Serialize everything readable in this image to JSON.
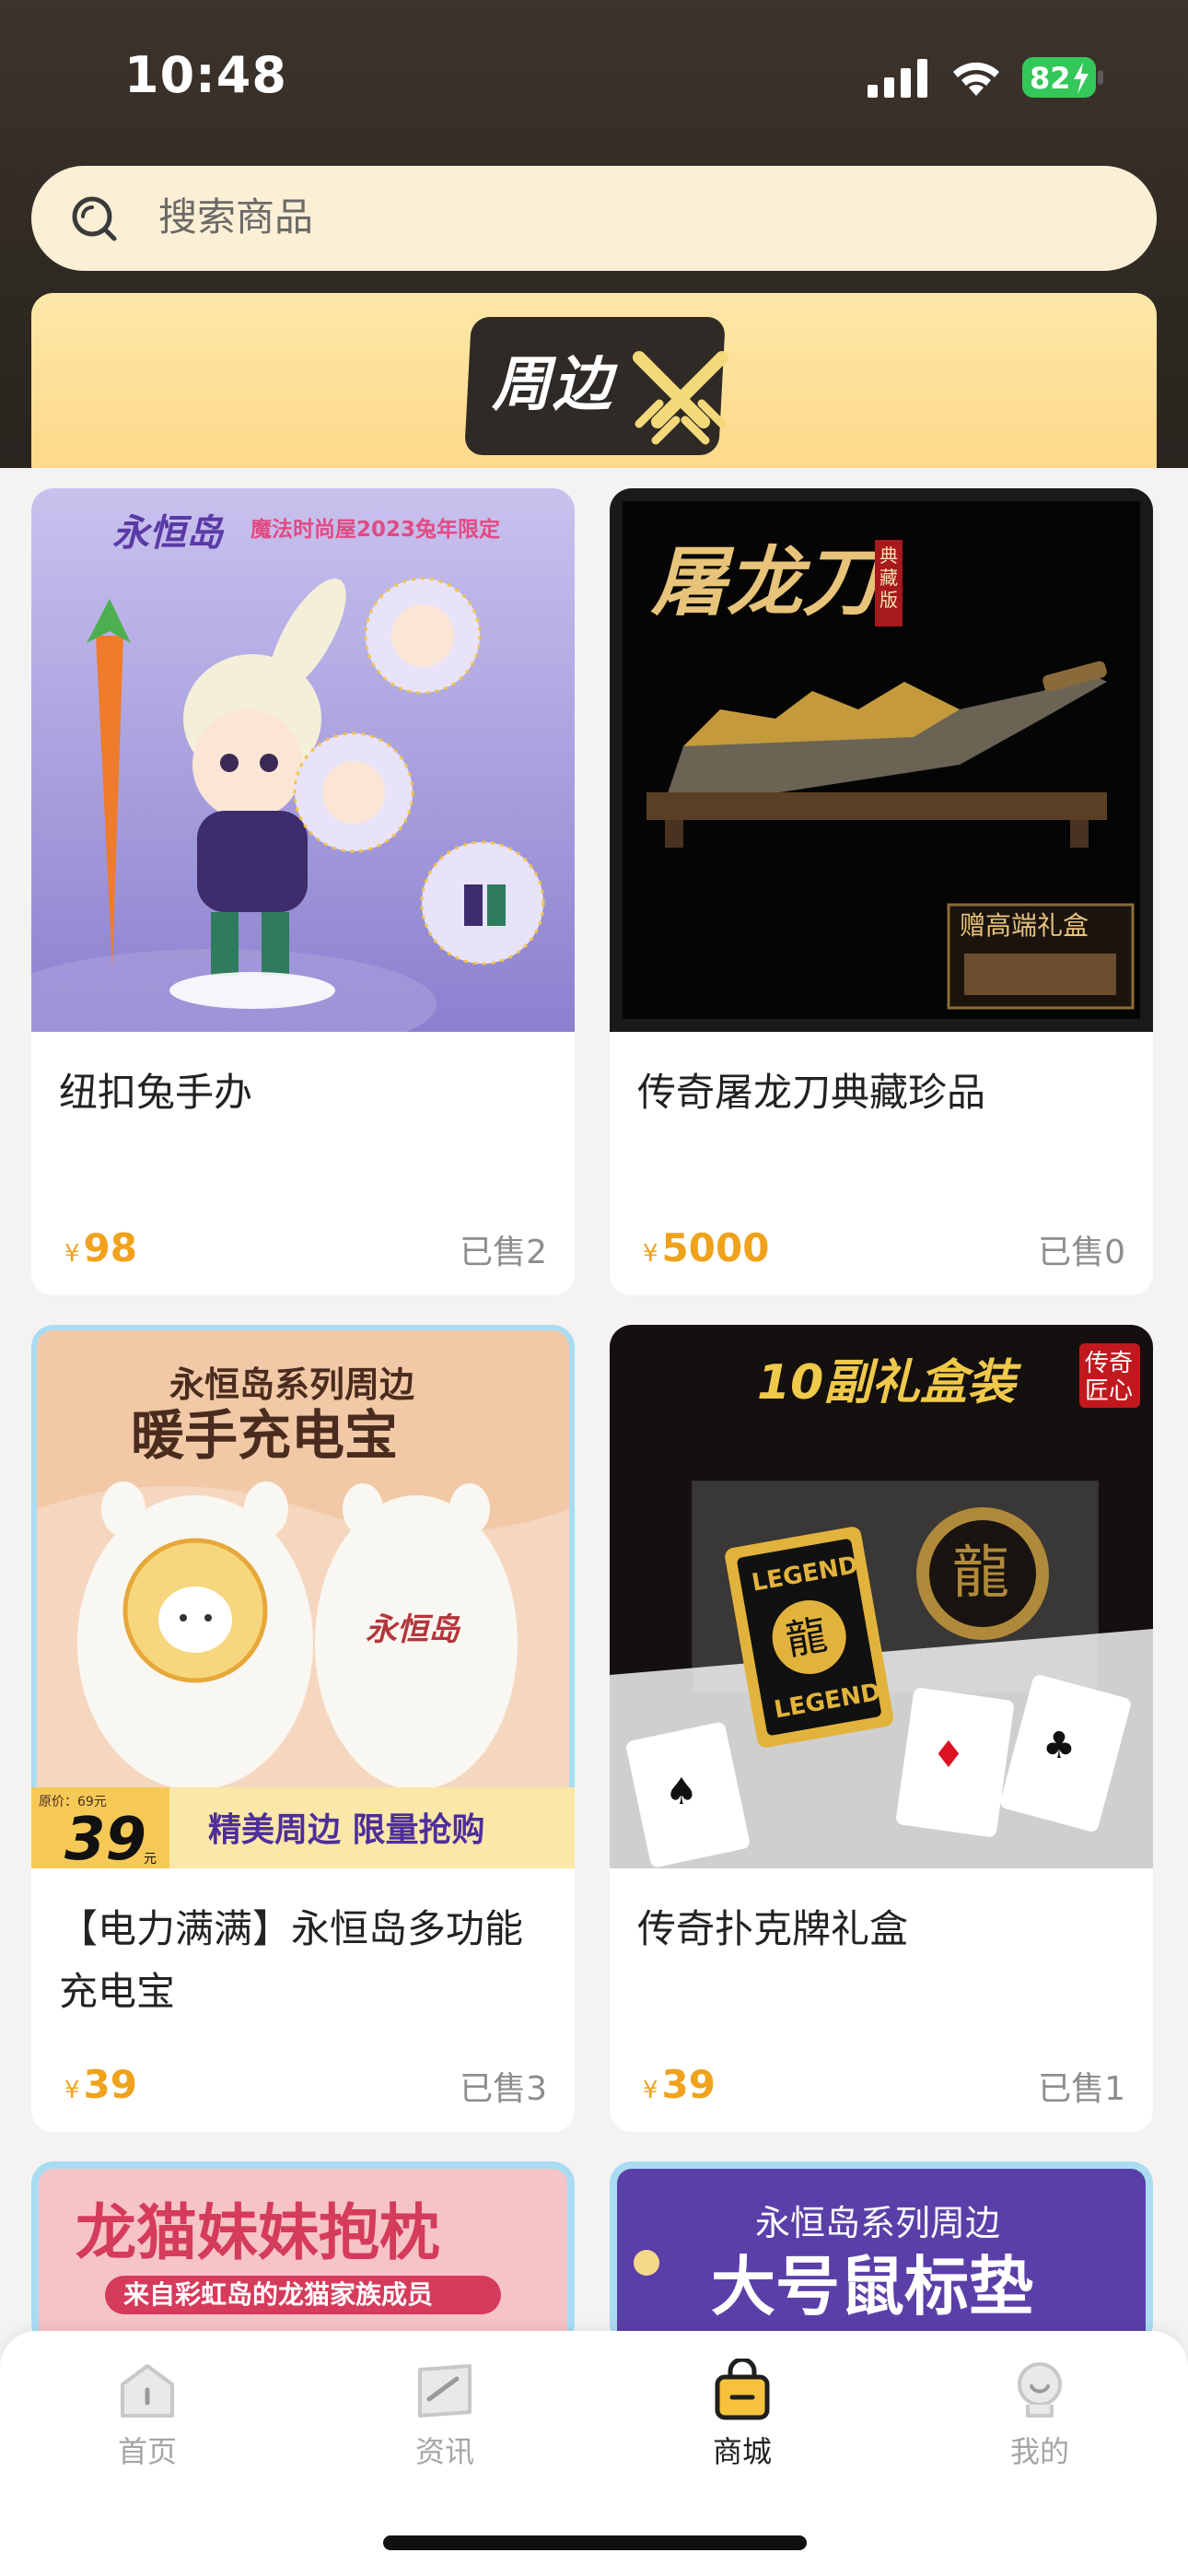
{
  "status_bar": {
    "time": "10:48",
    "battery": "82"
  },
  "search": {
    "placeholder": "搜索商品"
  },
  "banner": {
    "tag": "周边"
  },
  "products": [
    {
      "title": "纽扣兔手办",
      "price": "98",
      "sold": "已售2",
      "image_text": {
        "logo": "永恒岛",
        "headline": "魔法时尚屋2023兔年限定"
      }
    },
    {
      "title": "传奇屠龙刀典藏珍品",
      "price": "5000",
      "sold": "已售0",
      "image_text": {
        "headline": "屠龙刀",
        "badge": "典藏版",
        "box": "赠高端礼盒"
      }
    },
    {
      "title": "【电力满满】永恒岛多功能充电宝",
      "price": "39",
      "sold": "已售3",
      "image_text": {
        "line1": "永恒岛系列周边",
        "line2": "暖手充电宝",
        "orig": "原价：69元",
        "big_price": "39",
        "unit": "元",
        "slogan": "精美周边 限量抢购",
        "logo": "永恒岛"
      }
    },
    {
      "title": "传奇扑克牌礼盒",
      "price": "39",
      "sold": "已售1",
      "image_text": {
        "headline": "10副礼盒装",
        "badge1": "传奇",
        "badge2": "匠心",
        "card_top": "LEGEND",
        "card_bottom": "LEGEND",
        "dragon": "龍"
      }
    },
    {
      "image_text": {
        "headline": "龙猫妹妹抱枕",
        "sub": "来自彩虹岛的龙猫家族成员"
      }
    },
    {
      "image_text": {
        "line1": "永恒岛系列周边",
        "line2": "大号鼠标垫"
      }
    }
  ],
  "currency": "¥",
  "tabs": [
    {
      "label": "首页",
      "icon": "home-icon"
    },
    {
      "label": "资讯",
      "icon": "news-icon"
    },
    {
      "label": "商城",
      "icon": "shop-bag-icon",
      "active": true
    },
    {
      "label": "我的",
      "icon": "profile-icon"
    }
  ],
  "colors": {
    "accent": "#f0a21c",
    "header": "#2f2923",
    "search_bg": "#fbefd6",
    "banner": "#fde8a8"
  }
}
